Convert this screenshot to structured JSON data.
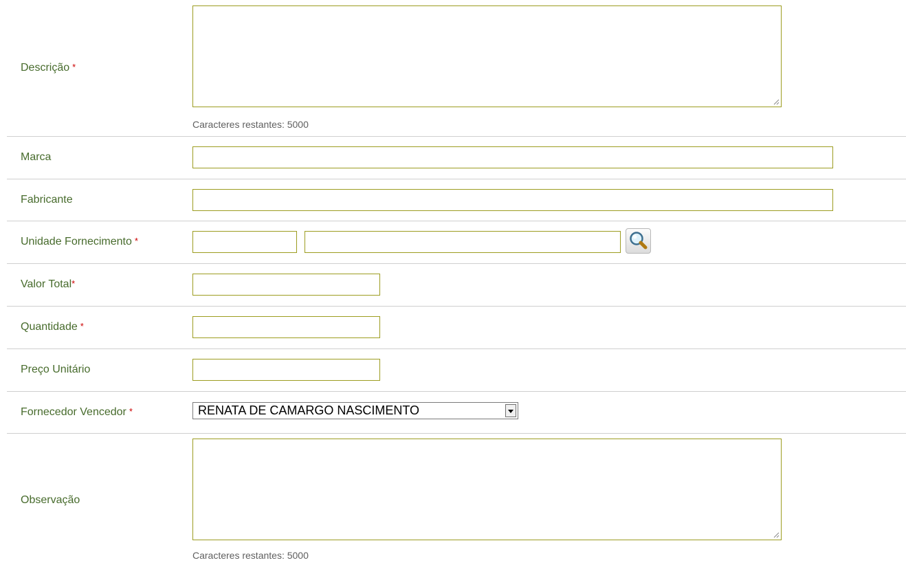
{
  "form": {
    "descricao": {
      "label": "Descrição",
      "required": "*",
      "value": "",
      "counter_text": "Caracteres restantes:",
      "counter_value": "5000"
    },
    "marca": {
      "label": "Marca",
      "value": ""
    },
    "fabricante": {
      "label": "Fabricante",
      "value": ""
    },
    "unidade_fornecimento": {
      "label": "Unidade Fornecimento",
      "required": "*",
      "code_value": "",
      "description_value": "",
      "lookup_icon": "search-icon"
    },
    "valor_total": {
      "label": "Valor Total",
      "required": "*",
      "value": ""
    },
    "quantidade": {
      "label": "Quantidade",
      "required": "*",
      "value": ""
    },
    "preco_unitario": {
      "label": "Preço Unitário",
      "value": ""
    },
    "fornecedor_vencedor": {
      "label": "Fornecedor Vencedor",
      "required": "*",
      "selected": "RENATA DE CAMARGO NASCIMENTO",
      "dropdown_icon": "chevron-down-icon"
    },
    "observacao": {
      "label": "Observação",
      "value": "",
      "counter_text": "Caracteres restantes:",
      "counter_value": "5000"
    }
  },
  "colors": {
    "label": "#476b2c",
    "required": "#cc0000",
    "input_border": "#9c9c1f",
    "divider": "#cfcfcf",
    "counter": "#5f5f5f"
  }
}
